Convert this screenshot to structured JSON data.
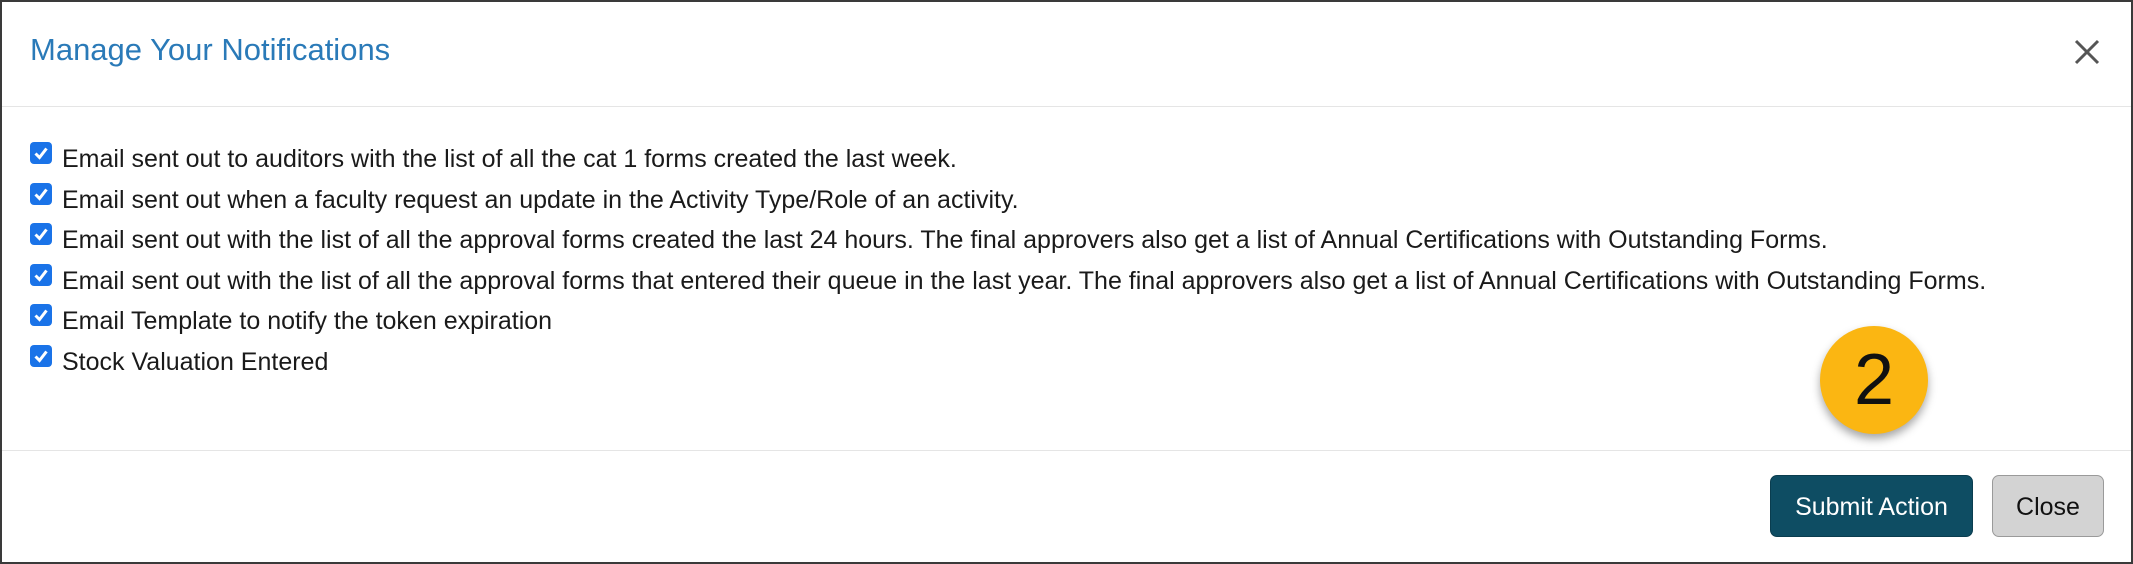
{
  "modal": {
    "title": "Manage Your Notifications",
    "close_icon": "close-icon"
  },
  "notifications": [
    {
      "checked": true,
      "label": "Email sent out to auditors with the list of all the cat 1 forms created the last week."
    },
    {
      "checked": true,
      "label": "Email sent out when a faculty request an update in the Activity Type/Role of an activity."
    },
    {
      "checked": true,
      "label": "Email sent out with the list of all the approval forms created the last 24 hours. The final approvers also get a list of Annual Certifications with Outstanding Forms."
    },
    {
      "checked": true,
      "label": "Email sent out with the list of all the approval forms that entered their queue in the last year. The final approvers also get a list of Annual Certifications with Outstanding Forms."
    },
    {
      "checked": true,
      "label": "Email Template to notify the token expiration"
    },
    {
      "checked": true,
      "label": "Stock Valuation Entered"
    }
  ],
  "step_badge": "2",
  "footer": {
    "submit_label": "Submit Action",
    "close_label": "Close"
  },
  "colors": {
    "title": "#2a7ab8",
    "checkbox": "#1a73e8",
    "primary_button": "#0e4d63",
    "secondary_button": "#d3d3d3",
    "badge": "#fbb612"
  }
}
